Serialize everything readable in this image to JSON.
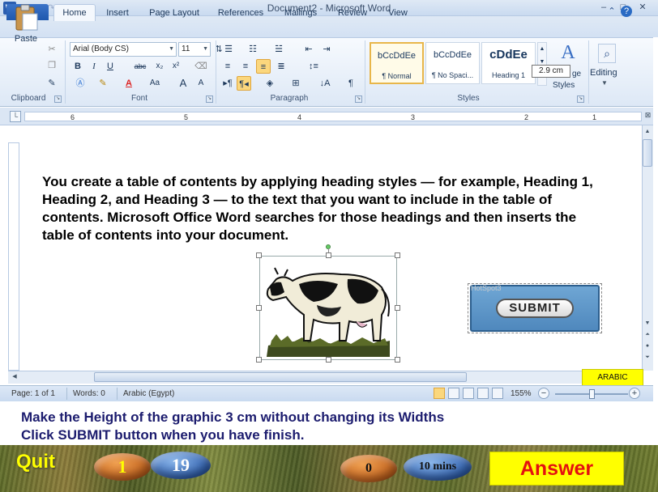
{
  "window": {
    "title": "Document2 - Microsoft Word",
    "app_icon": "W",
    "controls": [
      "–",
      "□",
      "✕"
    ]
  },
  "tabs": {
    "file": "File",
    "items": [
      "Home",
      "Insert",
      "Page Layout",
      "References",
      "Mailings",
      "Review",
      "View"
    ],
    "active": "Home"
  },
  "ribbon": {
    "clipboard": {
      "label": "Clipboard",
      "paste": "Paste"
    },
    "font": {
      "label": "Font",
      "font_name": "Arial (Body CS)",
      "font_size": "11",
      "bold": "B",
      "italic": "I",
      "underline": "U",
      "strike": "abc",
      "subscript": "x₂",
      "superscript": "x²",
      "grow": "A",
      "shrink": "A",
      "case": "Aa"
    },
    "paragraph": {
      "label": "Paragraph"
    },
    "styles": {
      "label": "Styles",
      "items": [
        {
          "sample": "bCcDdEe",
          "name": "¶ Normal"
        },
        {
          "sample": "bCcDdEe",
          "name": "¶ No Spaci..."
        },
        {
          "sample": "cDdEe",
          "name": "Heading 1"
        }
      ],
      "change_styles": "Styles",
      "change_prefix": "ge"
    },
    "editing": {
      "label": "Editing"
    }
  },
  "tooltip": {
    "text": "2.9 cm"
  },
  "ruler": {
    "numbers": [
      "6",
      "5",
      "4",
      "3",
      "2",
      "1",
      "1",
      "2"
    ]
  },
  "document": {
    "paragraph": "You create a table of contents by applying heading styles — for example, Heading 1, Heading 2, and Heading 3 — to the text that you want to include in the table of contents. Microsoft Office Word searches for those headings and then inserts the table of contents into your document."
  },
  "hotspot": {
    "label": "HotSpot3",
    "button": "SUBMIT"
  },
  "language_badge": "ARABIC",
  "status": {
    "page": "Page: 1 of 1",
    "words": "Words: 0",
    "language": "Arabic (Egypt)",
    "zoom": "155%",
    "zoom_minus": "−",
    "zoom_plus": "+"
  },
  "instructions": {
    "line1": "Make the Height of the graphic 3 cm without changing its Widths",
    "line2": "Click SUBMIT button when you have finish."
  },
  "bottom": {
    "quit": "Quit",
    "counter1": "1",
    "counter2": "19",
    "counter3": "0",
    "timer": "10 mins",
    "answer": "Answer"
  },
  "colors": {
    "answer_text": "#e41010",
    "answer_bg": "#ffff00",
    "quit_text": "#ffff00",
    "instructions_text": "#1c1c6e"
  }
}
